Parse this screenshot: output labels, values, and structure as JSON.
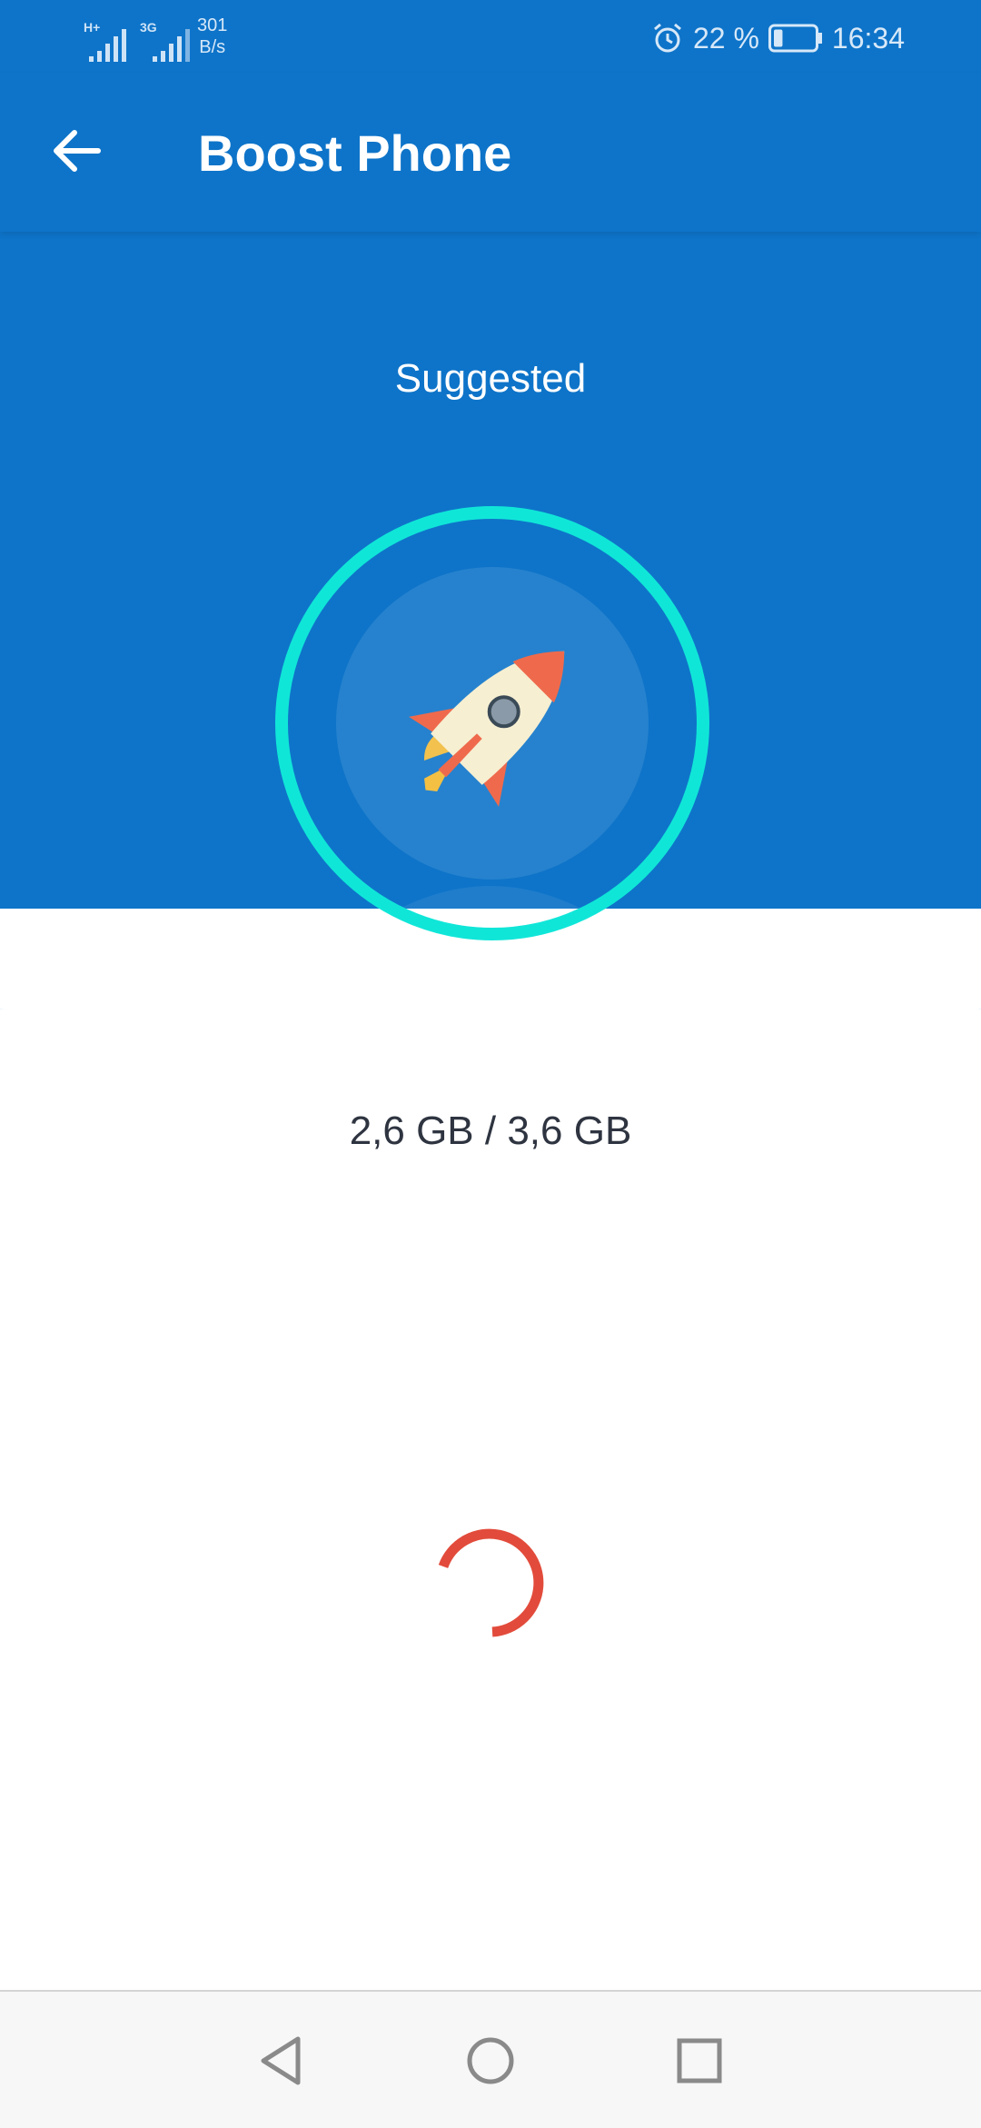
{
  "status_bar": {
    "network_type_1": "H+",
    "network_type_2": "3G",
    "speed_value": "301",
    "speed_unit": "B/s",
    "battery_percent": "22 %",
    "battery_level": 0.22,
    "time": "16:34"
  },
  "toolbar": {
    "title": "Boost Phone"
  },
  "main": {
    "status_label": "Suggested",
    "memory_usage": "2,6 GB / 3,6 GB"
  },
  "colors": {
    "primary_blue": "#0e74c9",
    "ring_cyan": "#10e6d8",
    "spinner_red": "#e24b3b"
  },
  "icons": {
    "back": "arrow-left-icon",
    "center": "rocket-icon",
    "nav_back": "triangle-back-icon",
    "nav_home": "circle-home-icon",
    "nav_recents": "square-recents-icon"
  }
}
